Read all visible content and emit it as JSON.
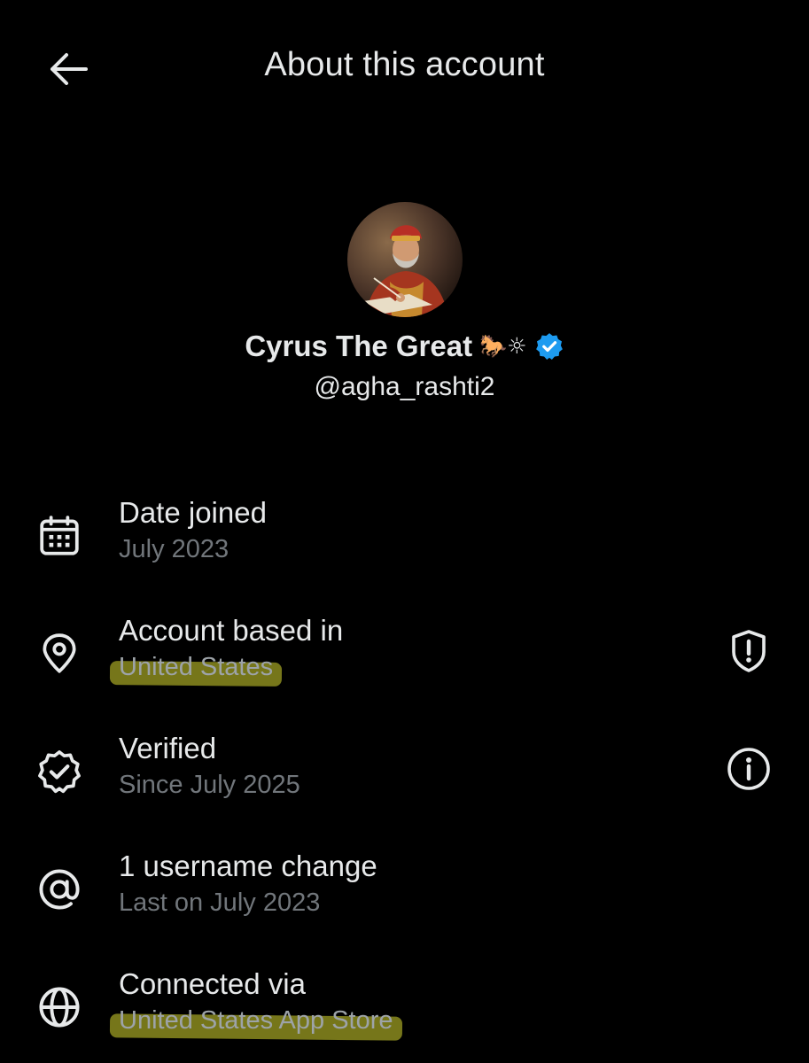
{
  "header": {
    "title": "About this account"
  },
  "profile": {
    "display_name": "Cyrus The Great",
    "name_emoji": "🐎☼",
    "handle": "@agha_rashti2",
    "verified_color": "#1d9bf0"
  },
  "rows": [
    {
      "title": "Date joined",
      "subtitle": "July 2023",
      "icon": "calendar-icon"
    },
    {
      "title": "Account based in",
      "subtitle": "United States",
      "icon": "location-pin-icon",
      "action_icon": "shield-alert-icon"
    },
    {
      "title": "Verified",
      "subtitle": "Since July 2025",
      "icon": "verified-badge-icon",
      "action_icon": "info-icon"
    },
    {
      "title": "1 username change",
      "subtitle": "Last on July 2023",
      "icon": "at-sign-icon"
    },
    {
      "title": "Connected via",
      "subtitle": "United States App Store",
      "icon": "globe-icon"
    }
  ],
  "colors": {
    "background": "#000000",
    "primary_text": "#e7e9ea",
    "secondary_text": "#71767b",
    "highlight": "#8b8b1e"
  }
}
